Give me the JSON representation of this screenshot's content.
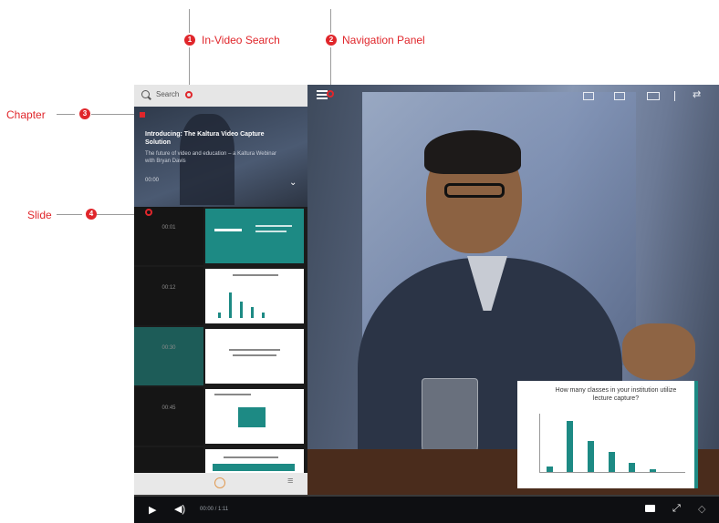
{
  "callouts": {
    "in_video_search": {
      "number": "1",
      "label": "In-Video Search"
    },
    "navigation_panel": {
      "number": "2",
      "label": "Navigation Panel"
    },
    "chapter": {
      "number": "3",
      "label": "Chapter"
    },
    "slide": {
      "number": "4",
      "label": "Slide"
    }
  },
  "player": {
    "search_placeholder": "Search",
    "chapter_title": "Introducing: The Kaltura Video Capture Solution",
    "chapter_subtitle": "The future of video and education – a Kaltura Webinar with Bryan Davis",
    "chapter_time": "00:00",
    "slides": [
      {
        "time": "00:01"
      },
      {
        "time": "00:12"
      },
      {
        "time": "00:30"
      },
      {
        "time": "00:45"
      }
    ],
    "overlay_slide": {
      "title": "How many classes in your institution utilize lecture capture?"
    },
    "controls": {
      "time": "00:00 / 1:11"
    },
    "accent_color": "#1d8a84",
    "callout_color": "#e0262b"
  }
}
